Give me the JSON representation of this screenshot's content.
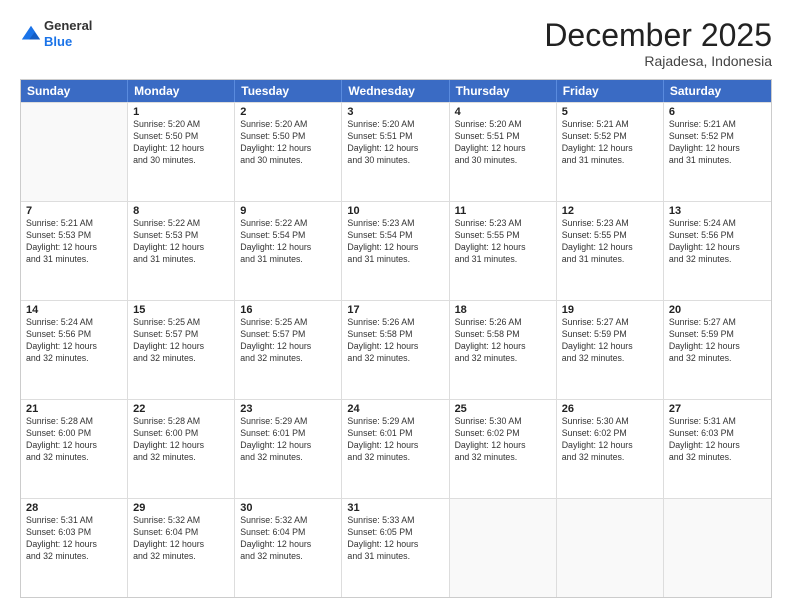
{
  "logo": {
    "general": "General",
    "blue": "Blue"
  },
  "title": "December 2025",
  "subtitle": "Rajadesa, Indonesia",
  "header": {
    "days": [
      "Sunday",
      "Monday",
      "Tuesday",
      "Wednesday",
      "Thursday",
      "Friday",
      "Saturday"
    ]
  },
  "weeks": [
    [
      {
        "day": "",
        "info": ""
      },
      {
        "day": "1",
        "info": "Sunrise: 5:20 AM\nSunset: 5:50 PM\nDaylight: 12 hours\nand 30 minutes."
      },
      {
        "day": "2",
        "info": "Sunrise: 5:20 AM\nSunset: 5:50 PM\nDaylight: 12 hours\nand 30 minutes."
      },
      {
        "day": "3",
        "info": "Sunrise: 5:20 AM\nSunset: 5:51 PM\nDaylight: 12 hours\nand 30 minutes."
      },
      {
        "day": "4",
        "info": "Sunrise: 5:20 AM\nSunset: 5:51 PM\nDaylight: 12 hours\nand 30 minutes."
      },
      {
        "day": "5",
        "info": "Sunrise: 5:21 AM\nSunset: 5:52 PM\nDaylight: 12 hours\nand 31 minutes."
      },
      {
        "day": "6",
        "info": "Sunrise: 5:21 AM\nSunset: 5:52 PM\nDaylight: 12 hours\nand 31 minutes."
      }
    ],
    [
      {
        "day": "7",
        "info": "Sunrise: 5:21 AM\nSunset: 5:53 PM\nDaylight: 12 hours\nand 31 minutes."
      },
      {
        "day": "8",
        "info": "Sunrise: 5:22 AM\nSunset: 5:53 PM\nDaylight: 12 hours\nand 31 minutes."
      },
      {
        "day": "9",
        "info": "Sunrise: 5:22 AM\nSunset: 5:54 PM\nDaylight: 12 hours\nand 31 minutes."
      },
      {
        "day": "10",
        "info": "Sunrise: 5:23 AM\nSunset: 5:54 PM\nDaylight: 12 hours\nand 31 minutes."
      },
      {
        "day": "11",
        "info": "Sunrise: 5:23 AM\nSunset: 5:55 PM\nDaylight: 12 hours\nand 31 minutes."
      },
      {
        "day": "12",
        "info": "Sunrise: 5:23 AM\nSunset: 5:55 PM\nDaylight: 12 hours\nand 31 minutes."
      },
      {
        "day": "13",
        "info": "Sunrise: 5:24 AM\nSunset: 5:56 PM\nDaylight: 12 hours\nand 32 minutes."
      }
    ],
    [
      {
        "day": "14",
        "info": "Sunrise: 5:24 AM\nSunset: 5:56 PM\nDaylight: 12 hours\nand 32 minutes."
      },
      {
        "day": "15",
        "info": "Sunrise: 5:25 AM\nSunset: 5:57 PM\nDaylight: 12 hours\nand 32 minutes."
      },
      {
        "day": "16",
        "info": "Sunrise: 5:25 AM\nSunset: 5:57 PM\nDaylight: 12 hours\nand 32 minutes."
      },
      {
        "day": "17",
        "info": "Sunrise: 5:26 AM\nSunset: 5:58 PM\nDaylight: 12 hours\nand 32 minutes."
      },
      {
        "day": "18",
        "info": "Sunrise: 5:26 AM\nSunset: 5:58 PM\nDaylight: 12 hours\nand 32 minutes."
      },
      {
        "day": "19",
        "info": "Sunrise: 5:27 AM\nSunset: 5:59 PM\nDaylight: 12 hours\nand 32 minutes."
      },
      {
        "day": "20",
        "info": "Sunrise: 5:27 AM\nSunset: 5:59 PM\nDaylight: 12 hours\nand 32 minutes."
      }
    ],
    [
      {
        "day": "21",
        "info": "Sunrise: 5:28 AM\nSunset: 6:00 PM\nDaylight: 12 hours\nand 32 minutes."
      },
      {
        "day": "22",
        "info": "Sunrise: 5:28 AM\nSunset: 6:00 PM\nDaylight: 12 hours\nand 32 minutes."
      },
      {
        "day": "23",
        "info": "Sunrise: 5:29 AM\nSunset: 6:01 PM\nDaylight: 12 hours\nand 32 minutes."
      },
      {
        "day": "24",
        "info": "Sunrise: 5:29 AM\nSunset: 6:01 PM\nDaylight: 12 hours\nand 32 minutes."
      },
      {
        "day": "25",
        "info": "Sunrise: 5:30 AM\nSunset: 6:02 PM\nDaylight: 12 hours\nand 32 minutes."
      },
      {
        "day": "26",
        "info": "Sunrise: 5:30 AM\nSunset: 6:02 PM\nDaylight: 12 hours\nand 32 minutes."
      },
      {
        "day": "27",
        "info": "Sunrise: 5:31 AM\nSunset: 6:03 PM\nDaylight: 12 hours\nand 32 minutes."
      }
    ],
    [
      {
        "day": "28",
        "info": "Sunrise: 5:31 AM\nSunset: 6:03 PM\nDaylight: 12 hours\nand 32 minutes."
      },
      {
        "day": "29",
        "info": "Sunrise: 5:32 AM\nSunset: 6:04 PM\nDaylight: 12 hours\nand 32 minutes."
      },
      {
        "day": "30",
        "info": "Sunrise: 5:32 AM\nSunset: 6:04 PM\nDaylight: 12 hours\nand 32 minutes."
      },
      {
        "day": "31",
        "info": "Sunrise: 5:33 AM\nSunset: 6:05 PM\nDaylight: 12 hours\nand 31 minutes."
      },
      {
        "day": "",
        "info": ""
      },
      {
        "day": "",
        "info": ""
      },
      {
        "day": "",
        "info": ""
      }
    ]
  ]
}
